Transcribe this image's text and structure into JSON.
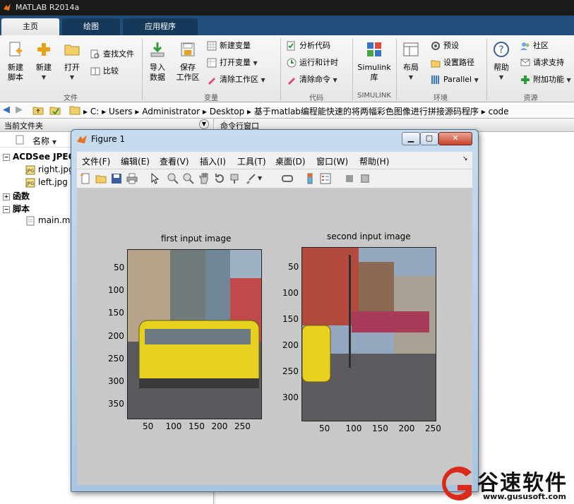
{
  "app": {
    "title": "MATLAB R2014a"
  },
  "tabs": [
    {
      "label": "主页"
    },
    {
      "label": "绘图"
    },
    {
      "label": "应用程序"
    }
  ],
  "ribbon": {
    "file": {
      "new_script": "新建\n脚本",
      "new": "新建",
      "open": "打开",
      "find_files": "查找文件",
      "compare": "比较",
      "group_label": "文件"
    },
    "variable": {
      "import_data": "导入\n数据",
      "save_workspace": "保存\n工作区",
      "new_variable": "新建变量",
      "open_variable": "打开变量",
      "clear_workspace": "清除工作区",
      "group_label": "变量"
    },
    "code": {
      "analyze_code": "分析代码",
      "run_and_time": "运行和计时",
      "clear_commands": "清除命令",
      "group_label": "代码"
    },
    "simulink": {
      "library": "Simulink\n库",
      "group_label": "SIMULINK"
    },
    "environment": {
      "layout": "布局",
      "preferences": "预设",
      "set_path": "设置路径",
      "parallel": "Parallel",
      "group_label": "环境"
    },
    "resources": {
      "help": "帮助",
      "community": "社区",
      "request_support": "请求支持",
      "add_ons": "附加功能",
      "group_label": "资源"
    }
  },
  "address": {
    "crumbs": [
      "C:",
      "Users",
      "Administrator",
      "Desktop",
      "基于matlab编程能快速的将两幅彩色图像进行拼接源码程序",
      "code"
    ]
  },
  "current_folder": {
    "title": "当前文件夹",
    "column_name": "名称",
    "groups": [
      {
        "label": "ACDSee JPEG",
        "items": [
          "right.jpg",
          "left.jpg"
        ]
      },
      {
        "label": "函数",
        "items": []
      },
      {
        "label": "脚本",
        "items": [
          "main.m"
        ]
      }
    ]
  },
  "command_window": {
    "title": "命令行窗口"
  },
  "figure": {
    "title": "Figure 1",
    "menu": [
      "文件(F)",
      "编辑(E)",
      "查看(V)",
      "插入(I)",
      "工具(T)",
      "桌面(D)",
      "窗口(W)",
      "帮助(H)"
    ],
    "axes": [
      {
        "title": "first input image",
        "xticks": [
          "50",
          "100",
          "150",
          "200",
          "250"
        ],
        "yticks": [
          "50",
          "100",
          "150",
          "200",
          "250",
          "300",
          "350"
        ]
      },
      {
        "title": "second input image",
        "xticks": [
          "50",
          "100",
          "150",
          "200",
          "250"
        ],
        "yticks": [
          "50",
          "100",
          "150",
          "200",
          "250",
          "300"
        ]
      }
    ]
  },
  "watermark": {
    "brand": "谷速软件",
    "url": "www.gususoft.com"
  }
}
